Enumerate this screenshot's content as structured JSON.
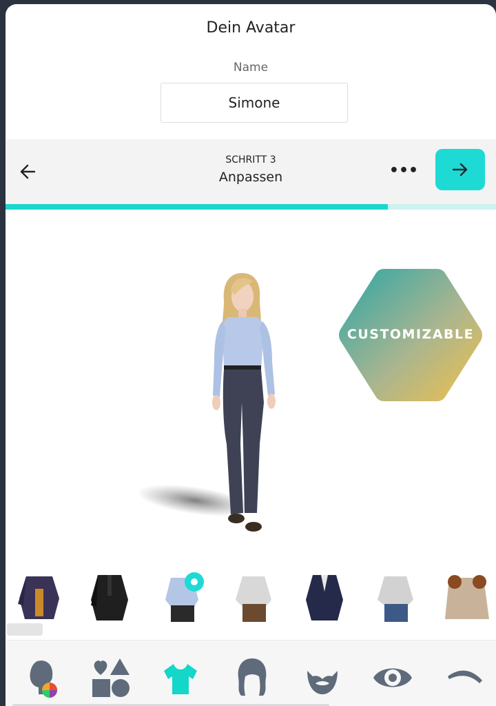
{
  "header": {
    "title": "Dein Avatar",
    "name_label": "Name",
    "name_value": "Simone"
  },
  "stepper": {
    "step_label": "SCHRITT 3",
    "step_title": "Anpassen",
    "more_label": "•••",
    "progress": 0.78
  },
  "badge": {
    "text": "CUSTOMIZABLE"
  },
  "outfits": [
    {
      "icon": "outfit-purple-jacket-icon"
    },
    {
      "icon": "outfit-black-suit-icon"
    },
    {
      "icon": "outfit-blue-shirt-icon",
      "selected": true
    },
    {
      "icon": "outfit-white-shirt-icon"
    },
    {
      "icon": "outfit-navy-suit-icon"
    },
    {
      "icon": "outfit-grey-jeans-icon"
    },
    {
      "icon": "outfit-fur-coat-icon"
    }
  ],
  "tabs": [
    {
      "icon": "head-color-icon"
    },
    {
      "icon": "shapes-icon"
    },
    {
      "icon": "shirt-icon",
      "active": true
    },
    {
      "icon": "hair-icon"
    },
    {
      "icon": "beard-icon"
    },
    {
      "icon": "eye-icon"
    },
    {
      "icon": "eyebrow-icon"
    }
  ],
  "colors": {
    "accent": "#1edad4",
    "icon_grey": "#5f6b7a"
  }
}
